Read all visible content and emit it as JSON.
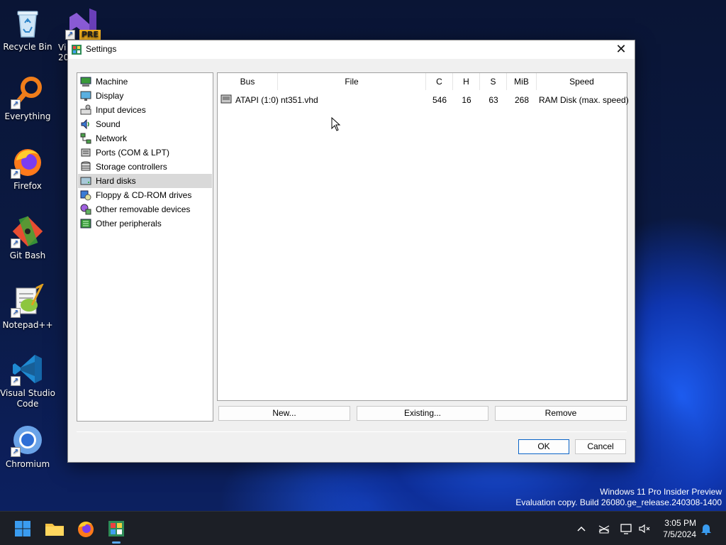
{
  "desktop": {
    "icons": [
      {
        "label": "Recycle Bin"
      },
      {
        "label": "Vi 20",
        "badge": "PRE"
      },
      {
        "label": "Everything"
      },
      {
        "label": "Firefox"
      },
      {
        "label": "Git Bash"
      },
      {
        "label": "Notepad++"
      },
      {
        "label": "Visual Studio Code"
      },
      {
        "label": "Chromium"
      }
    ],
    "watermark_line1": "Windows 11 Pro Insider Preview",
    "watermark_line2": "Evaluation copy. Build 26080.ge_release.240308-1400"
  },
  "dialog": {
    "title": "Settings",
    "close_glyph": "✕",
    "categories": [
      {
        "label": "Machine",
        "icon": "machine-icon"
      },
      {
        "label": "Display",
        "icon": "display-icon"
      },
      {
        "label": "Input devices",
        "icon": "input-devices-icon"
      },
      {
        "label": "Sound",
        "icon": "sound-icon"
      },
      {
        "label": "Network",
        "icon": "network-icon"
      },
      {
        "label": "Ports (COM & LPT)",
        "icon": "ports-icon"
      },
      {
        "label": "Storage controllers",
        "icon": "storage-controllers-icon"
      },
      {
        "label": "Hard disks",
        "icon": "hard-disks-icon",
        "selected": true
      },
      {
        "label": "Floppy & CD-ROM drives",
        "icon": "floppy-cdrom-icon"
      },
      {
        "label": "Other removable devices",
        "icon": "removable-devices-icon"
      },
      {
        "label": "Other peripherals",
        "icon": "peripherals-icon"
      }
    ],
    "disk_table": {
      "columns": [
        "Bus",
        "File",
        "C",
        "H",
        "S",
        "MiB",
        "Speed"
      ],
      "rows": [
        {
          "bus": "ATAPI (1:0)",
          "file": "nt351.vhd",
          "c": "546",
          "h": "16",
          "s": "63",
          "mib": "268",
          "speed": "RAM Disk (max. speed)"
        }
      ]
    },
    "buttons": {
      "new": "New...",
      "existing": "Existing...",
      "remove": "Remove",
      "ok": "OK",
      "cancel": "Cancel"
    }
  },
  "taskbar": {
    "time": "3:05 PM",
    "date": "7/5/2024"
  },
  "colors": {
    "accent": "#0a64c8",
    "selection": "#d9d9d9"
  }
}
